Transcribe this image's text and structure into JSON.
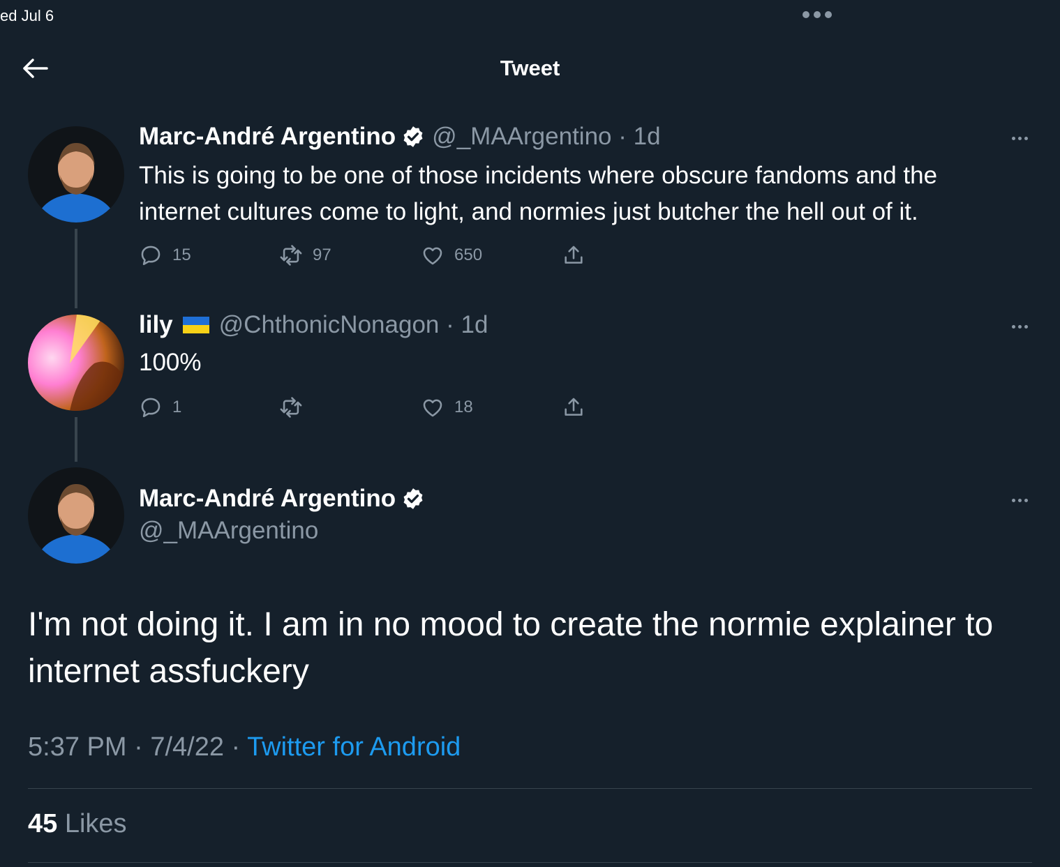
{
  "status_bar": {
    "date": "ed Jul 6"
  },
  "header": {
    "title": "Tweet"
  },
  "thread": [
    {
      "name": "Marc-André Argentino",
      "handle": "@_MAArgentino",
      "time": "1d",
      "text": "This is going to be one of those incidents where obscure fandoms and the internet cultures come to light, and normies just butcher the hell out of it.",
      "replies": "15",
      "retweets": "97",
      "likes": "650"
    },
    {
      "name": "lily",
      "handle": "@ChthonicNonagon",
      "time": "1d",
      "text": "100%",
      "replies": "1",
      "retweets": "",
      "likes": "18"
    }
  ],
  "main_tweet": {
    "name": "Marc-André Argentino",
    "handle": "@_MAArgentino",
    "text": "I'm not doing it. I am in no mood to create the normie explainer to internet assfuckery",
    "time": "5:37 PM",
    "date": "7/4/22",
    "source": "Twitter for Android",
    "likes_count": "45",
    "likes_label": "Likes"
  },
  "colors": {
    "background": "#15202b",
    "accent": "#1d9bf0",
    "muted": "#8b98a5",
    "divider": "#38444d"
  }
}
